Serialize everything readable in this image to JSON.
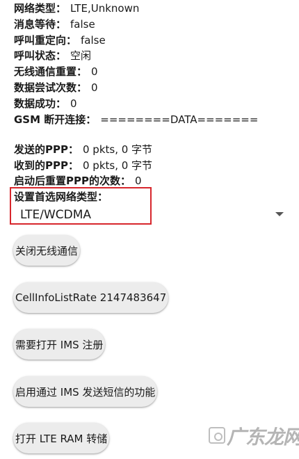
{
  "status_rows": [
    {
      "label": "网络类型：",
      "value": "LTE,Unknown"
    },
    {
      "label": "消息等待：",
      "value": "false"
    },
    {
      "label": "呼叫重定向：",
      "value": "false"
    },
    {
      "label": "呼叫状态：",
      "value": "空闲"
    },
    {
      "label": "无线通信重置：",
      "value": "0"
    },
    {
      "label": "数据尝试次数：",
      "value": "0"
    },
    {
      "label": "数据成功：",
      "value": "0"
    },
    {
      "label": "GSM 断开连接：",
      "value": "========DATA======="
    }
  ],
  "ppp_rows": [
    {
      "label": "发送的PPP：",
      "value": "0 pkts, 0 字节"
    },
    {
      "label": "收到的PPP：",
      "value": "0 pkts, 0 字节"
    },
    {
      "label": "启动后重置PPP的次数：",
      "value": "0"
    }
  ],
  "preferred_network": {
    "title": "设置首选网络类型：",
    "selected": "LTE/WCDMA",
    "highlight_color": "#d7262c"
  },
  "buttons": [
    {
      "label": "关闭无线通信"
    },
    {
      "label": "CellInfoListRate 2147483647"
    },
    {
      "label": "需要打开 IMS 注册"
    },
    {
      "label": "启用通过 IMS 发送短信的功能"
    },
    {
      "label": "打开 LTE RAM 转储"
    }
  ],
  "watermark": {
    "text": "广东龙网",
    "icon": "watermark-logo-icon"
  }
}
